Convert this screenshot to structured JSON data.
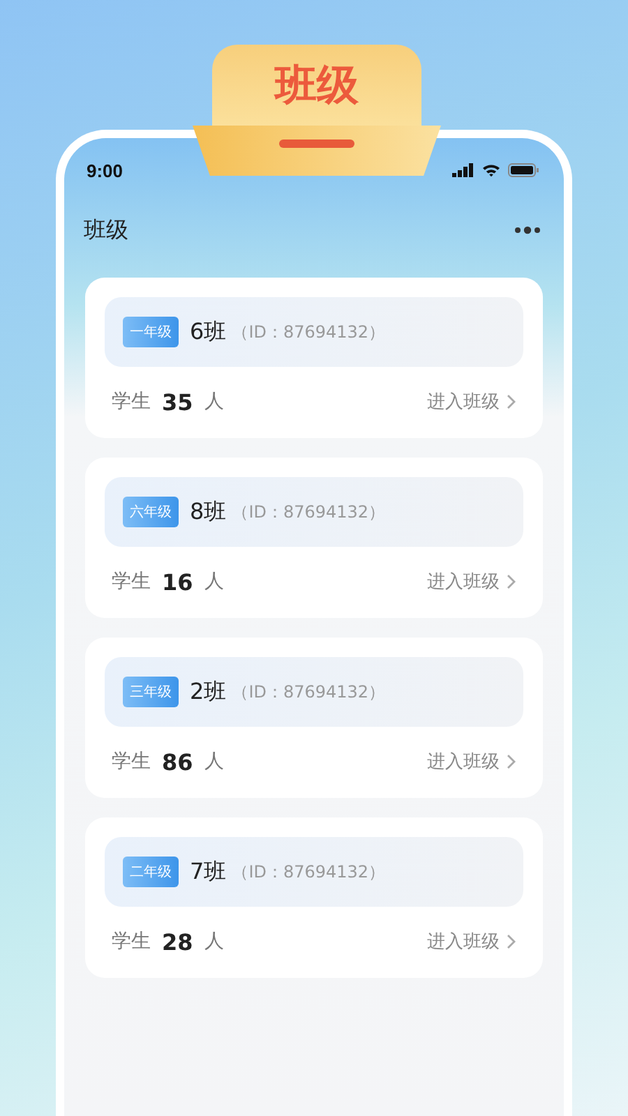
{
  "banner": {
    "title": "班级"
  },
  "status_bar": {
    "time": "9:00"
  },
  "header": {
    "title": "班级"
  },
  "classes": [
    {
      "grade": "一年级",
      "name": "6班",
      "id": "（ID：87694132）",
      "students_label": "学生",
      "student_count": "35",
      "unit": "人",
      "action": "进入班级"
    },
    {
      "grade": "六年级",
      "name": "8班",
      "id": "（ID：87694132）",
      "students_label": "学生",
      "student_count": "16",
      "unit": "人",
      "action": "进入班级"
    },
    {
      "grade": "三年级",
      "name": "2班",
      "id": "（ID：87694132）",
      "students_label": "学生",
      "student_count": "86",
      "unit": "人",
      "action": "进入班级"
    },
    {
      "grade": "二年级",
      "name": "7班",
      "id": "（ID：87694132）",
      "students_label": "学生",
      "student_count": "28",
      "unit": "人",
      "action": "进入班级"
    }
  ]
}
